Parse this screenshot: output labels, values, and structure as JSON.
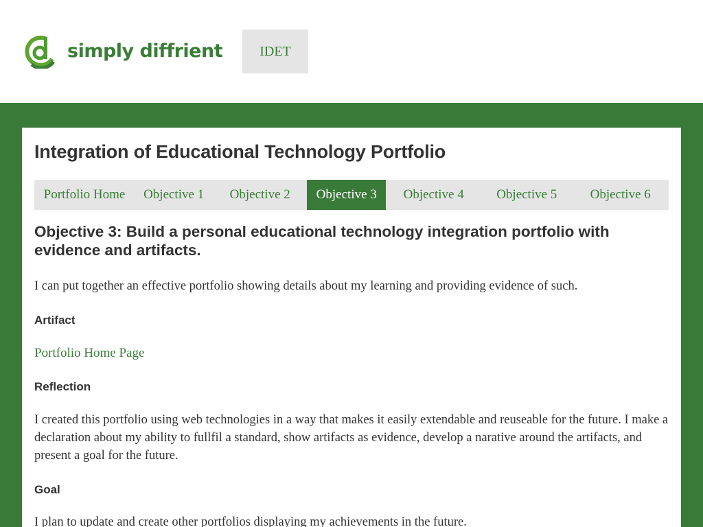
{
  "header": {
    "logo_text": "simply diffrient",
    "nav_item": "IDET"
  },
  "colors": {
    "brand_green": "#3a7d37",
    "band_green": "#3a7a38",
    "tab_bg": "#e5e5e5",
    "text": "#333333"
  },
  "main": {
    "title": "Integration of Educational Technology Portfolio",
    "tabs": [
      {
        "label": "Portfolio Home",
        "active": false
      },
      {
        "label": "Objective 1",
        "active": false
      },
      {
        "label": "Objective 2",
        "active": false
      },
      {
        "label": "Objective 3",
        "active": true
      },
      {
        "label": "Objective 4",
        "active": false
      },
      {
        "label": "Objective 5",
        "active": false
      },
      {
        "label": "Objective 6",
        "active": false
      }
    ],
    "objective_heading": "Objective 3: Build a personal educational technology integration portfolio with evidence and artifacts.",
    "intro": "I can put together an effective portfolio showing details about my learning and providing evidence of such.",
    "artifact_heading": "Artifact",
    "artifact_link": "Portfolio Home Page",
    "reflection_heading": "Reflection",
    "reflection_text": "I created this portfolio using web technologies in a way that makes it easily extendable and reuseable for the future. I make a declaration about my ability to fullfil a standard, show artifacts as evidence, develop a narative around the artifacts, and present a goal for the future.",
    "goal_heading": "Goal",
    "goal_text": "I plan to update and create other portfolios displaying my achievements in the future."
  }
}
